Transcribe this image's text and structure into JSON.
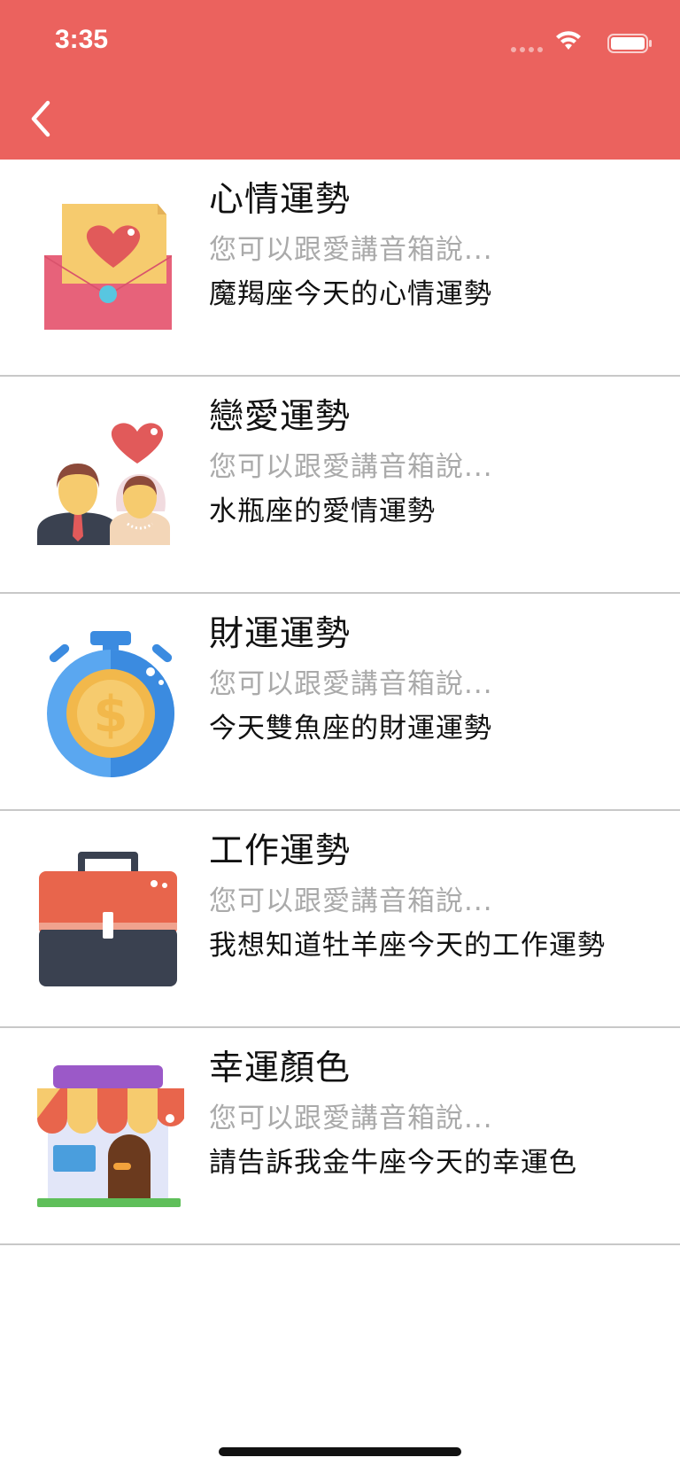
{
  "status_bar": {
    "time": "3:35",
    "icons": [
      "cellular-signal-icon",
      "wifi-icon",
      "battery-icon"
    ]
  },
  "header": {
    "background_color": "#EB625E",
    "back_icon": "chevron-left-icon"
  },
  "items": [
    {
      "title": "心情運勢",
      "hint": "您可以跟愛講音箱說...",
      "phrase": "魔羯座今天的心情運勢",
      "icon": "love-letter-icon"
    },
    {
      "title": "戀愛運勢",
      "hint": "您可以跟愛講音箱說...",
      "phrase": "水瓶座的愛情運勢",
      "icon": "couple-heart-icon"
    },
    {
      "title": "財運運勢",
      "hint": "您可以跟愛講音箱說...",
      "phrase": "今天雙魚座的財運運勢",
      "icon": "money-stopwatch-icon"
    },
    {
      "title": "工作運勢",
      "hint": "您可以跟愛講音箱說...",
      "phrase": "我想知道牡羊座今天的工作運勢",
      "icon": "briefcase-icon"
    },
    {
      "title": "幸運顏色",
      "hint": "您可以跟愛講音箱說...",
      "phrase": "請告訴我金牛座今天的幸運色",
      "icon": "shop-icon"
    }
  ]
}
